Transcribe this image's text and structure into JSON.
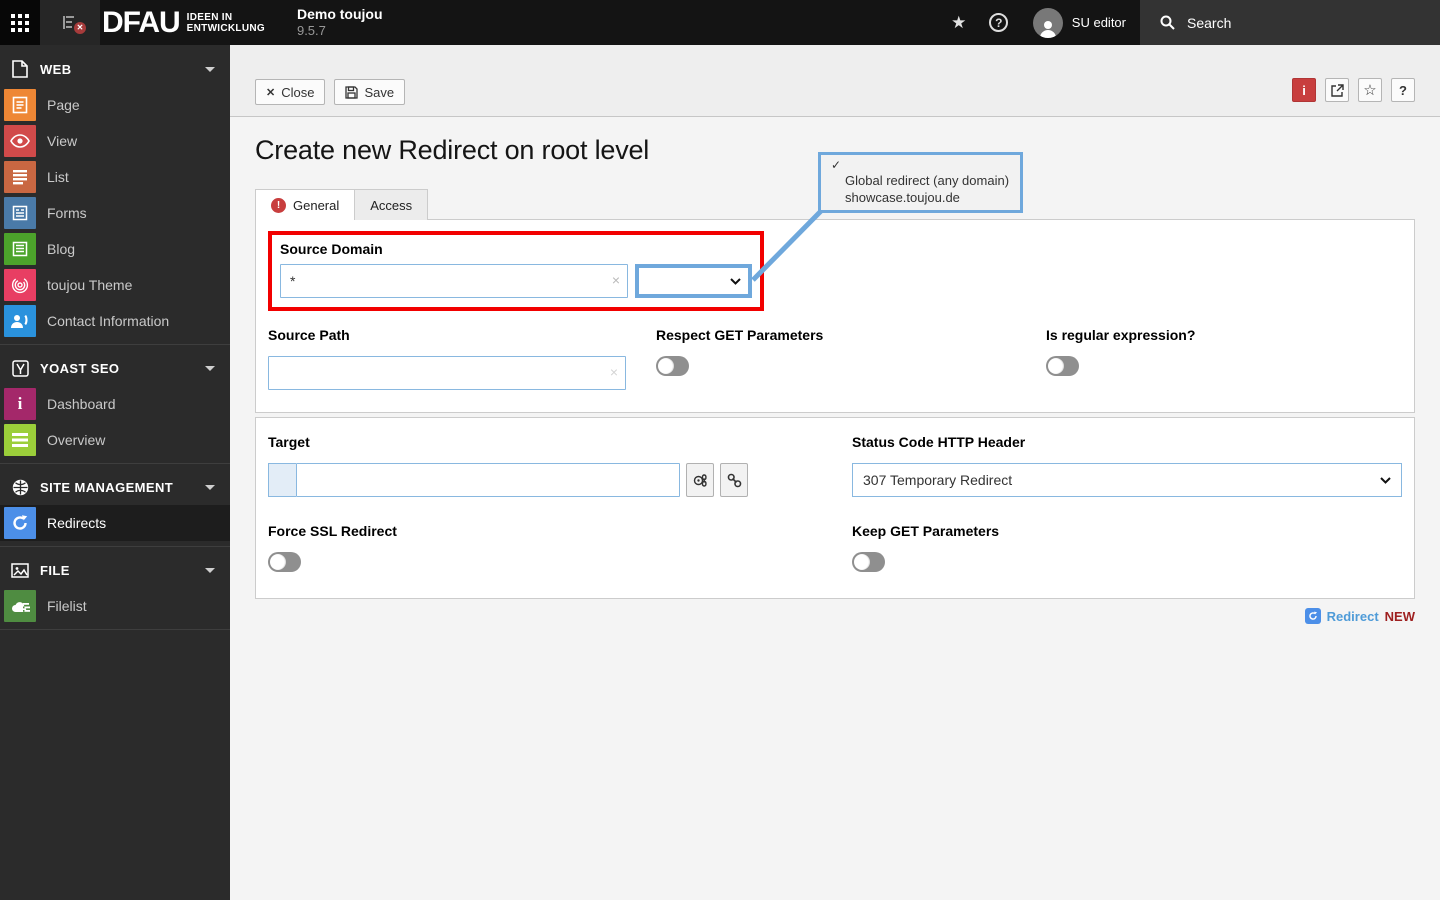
{
  "topbar": {
    "logo": "DFAU",
    "logo_claim_line1": "IDEEN IN",
    "logo_claim_line2": "ENTWICKLUNG",
    "site_name": "Demo toujou",
    "version": "9.5.7",
    "username": "SU editor",
    "search_placeholder": "Search"
  },
  "sidebar": {
    "sections": [
      {
        "label": "WEB",
        "items": [
          {
            "label": "Page"
          },
          {
            "label": "View"
          },
          {
            "label": "List"
          },
          {
            "label": "Forms"
          },
          {
            "label": "Blog"
          },
          {
            "label": "toujou Theme"
          },
          {
            "label": "Contact Information"
          }
        ]
      },
      {
        "label": "YOAST SEO",
        "items": [
          {
            "label": "Dashboard"
          },
          {
            "label": "Overview"
          }
        ]
      },
      {
        "label": "SITE MANAGEMENT",
        "items": [
          {
            "label": "Redirects"
          }
        ]
      },
      {
        "label": "FILE",
        "items": [
          {
            "label": "Filelist"
          }
        ]
      }
    ]
  },
  "docheader": {
    "close_label": "Close",
    "save_label": "Save",
    "info_glyph": "i",
    "help_glyph": "?"
  },
  "page": {
    "title": "Create new Redirect on root level"
  },
  "tabs": {
    "general": "General",
    "access": "Access"
  },
  "dropdown_callout": {
    "check": "✓",
    "option1": "Global redirect (any domain)",
    "option2": "showcase.toujou.de"
  },
  "form": {
    "source_domain_label": "Source Domain",
    "source_domain_value": "*",
    "source_path_label": "Source Path",
    "source_path_value": "",
    "respect_get_label": "Respect GET Parameters",
    "is_regex_label": "Is regular expression?",
    "target_label": "Target",
    "target_value": "",
    "status_code_label": "Status Code HTTP Header",
    "status_code_value": "307 Temporary Redirect",
    "force_ssl_label": "Force SSL Redirect",
    "keep_get_label": "Keep GET Parameters"
  },
  "footer": {
    "record_label": "Redirect",
    "state_label": "NEW"
  },
  "colors": {
    "highlight_red": "#f20000",
    "highlight_blue": "#6fa8dc",
    "input_border": "#89b8e0",
    "module_page": "#ee8735",
    "module_view": "#d14a4a",
    "module_list": "#c96742",
    "module_forms": "#4a7aa8",
    "module_blog": "#4ca32b",
    "module_theme": "#e83e63",
    "module_contact": "#2a92dd",
    "module_dashboard": "#a4286a",
    "module_overview": "#9bce3a",
    "module_redirects": "#4c8fe8",
    "module_filelist": "#4f8c41"
  }
}
